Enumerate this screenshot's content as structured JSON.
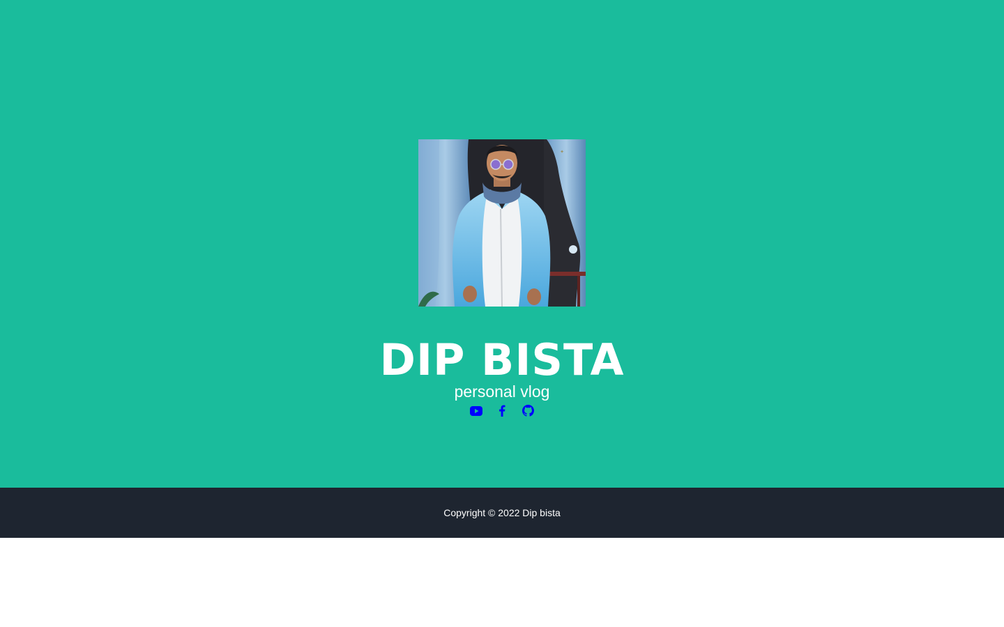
{
  "profile": {
    "name": "DIP BISTA",
    "tagline": "personal vlog",
    "photo_alt": "profile-photo"
  },
  "socials": [
    {
      "icon": "youtube-icon",
      "label": "YouTube"
    },
    {
      "icon": "facebook-icon",
      "label": "Facebook"
    },
    {
      "icon": "github-icon",
      "label": "GitHub"
    }
  ],
  "footer": {
    "copyright": "Copyright © 2022 Dip bista"
  },
  "colors": {
    "hero_bg": "#1abc9c",
    "footer_bg": "#1e2530",
    "text": "#ffffff",
    "icon": "#0000ff"
  }
}
